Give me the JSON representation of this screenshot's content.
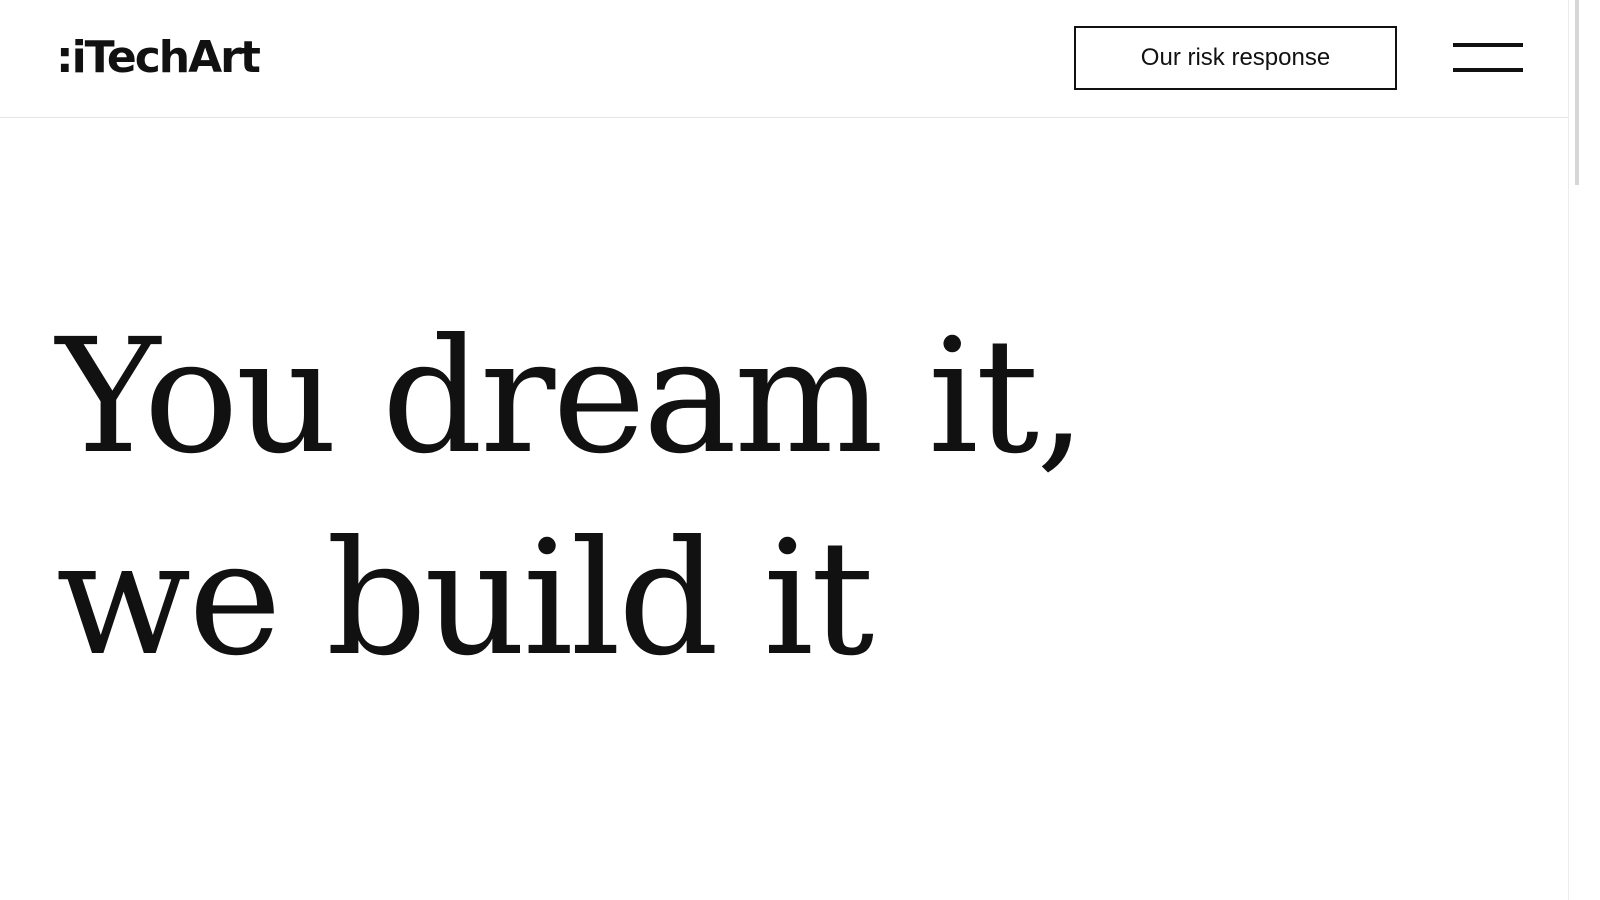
{
  "header": {
    "logo_text": ":iTechArt",
    "risk_button_label": "Our risk response",
    "menu_icon": "hamburger-menu-icon"
  },
  "hero": {
    "line1": "You dream it,",
    "line2": "we build it"
  },
  "colors": {
    "text": "#111111",
    "background": "#ffffff",
    "divider": "#e6e6e6"
  }
}
